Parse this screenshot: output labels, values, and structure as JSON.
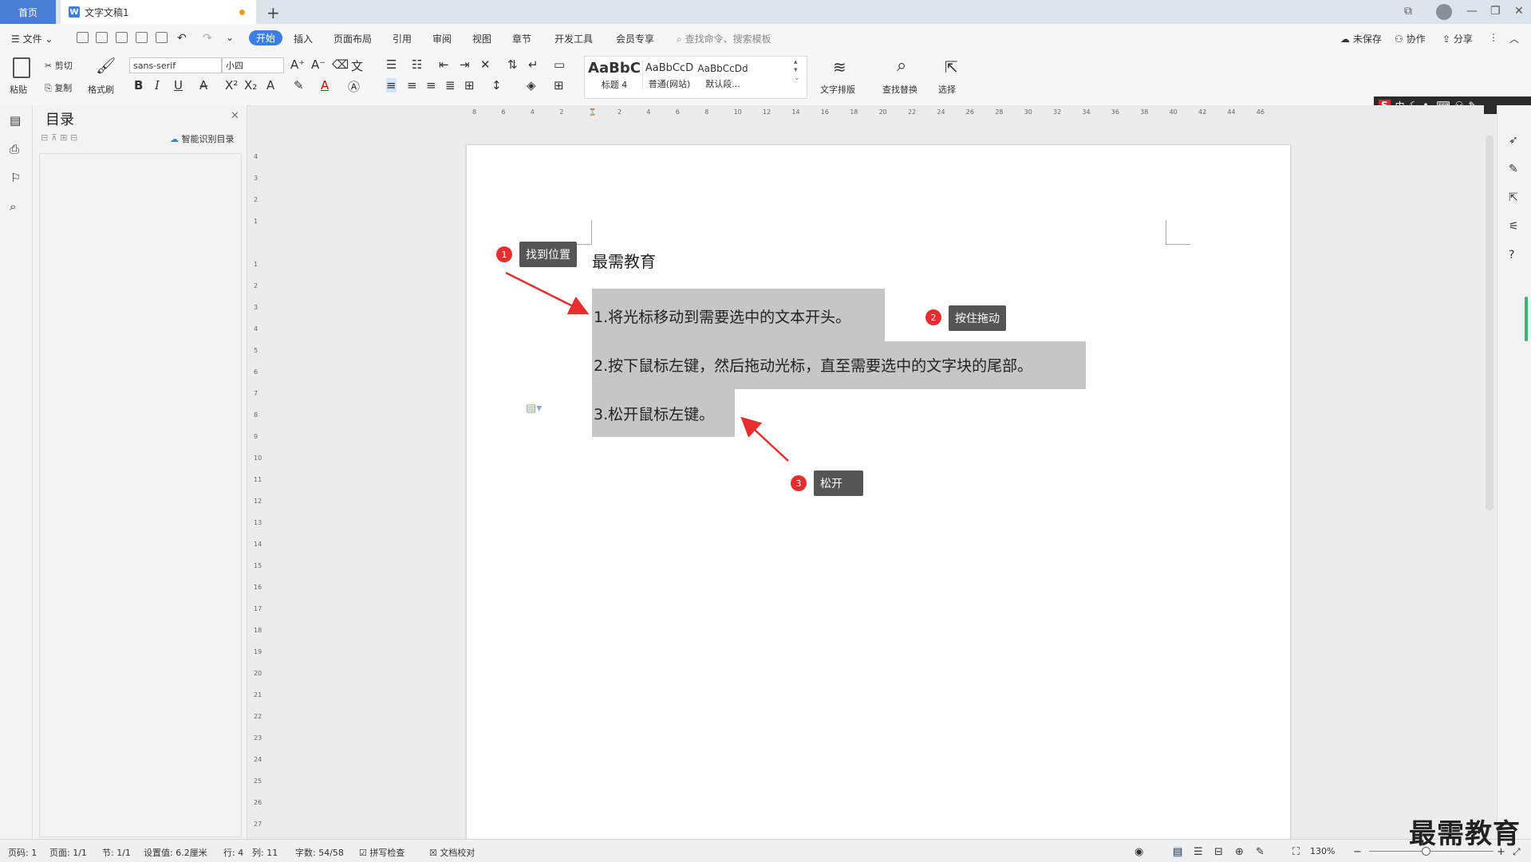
{
  "titlebar": {
    "home_tab": "首页",
    "doc_tab": "文字文稿1",
    "doc_icon": "W",
    "new_tab": "+"
  },
  "menu": {
    "file": "文件",
    "items": [
      "开始",
      "插入",
      "页面布局",
      "引用",
      "审阅",
      "视图",
      "章节",
      "开发工具",
      "会员专享"
    ],
    "search_placeholder": "查找命令、搜索模板",
    "unsaved": "未保存",
    "collab": "协作",
    "share": "分享"
  },
  "ribbon": {
    "paste": "粘贴",
    "cut": "剪切",
    "copy": "复制",
    "format_painter": "格式刷",
    "font_name": "sans-serif",
    "font_size": "小四",
    "styles": [
      {
        "sample": "AaBbC",
        "name": "标题 4"
      },
      {
        "sample": "AaBbCcD",
        "name": "普通(网站)"
      },
      {
        "sample": "AaBbCcDd",
        "name": "默认段..."
      }
    ],
    "text_layout": "文字排版",
    "find_replace": "查找替换",
    "select": "选择"
  },
  "toc": {
    "title": "目录",
    "smart_toc": "智能识别目录"
  },
  "document": {
    "heading": "最需教育",
    "lines": [
      "1.将光标移动到需要选中的文本开头。",
      "2.按下鼠标左键，然后拖动光标，直至需要选中的文字块的尾部。",
      "3.松开鼠标左键。"
    ]
  },
  "callouts": [
    {
      "num": "1",
      "text": "找到位置"
    },
    {
      "num": "2",
      "text": "按住拖动"
    },
    {
      "num": "3",
      "text": "松开"
    }
  ],
  "ime": {
    "text": "中"
  },
  "status": {
    "page_num": "页码: 1",
    "page": "页面: 1/1",
    "section": "节: 1/1",
    "setting": "设置值: 6.2厘米",
    "row": "行: 4",
    "col": "列: 11",
    "words": "字数: 54/58",
    "spell": "拼写检查",
    "proof": "文档校对",
    "zoom": "130%"
  },
  "watermark": "最需教育",
  "colors": {
    "accent": "#3d7fe0",
    "badge": "#e62e2e",
    "callout_bg": "#555555",
    "highlight": "#c6c6c6"
  }
}
